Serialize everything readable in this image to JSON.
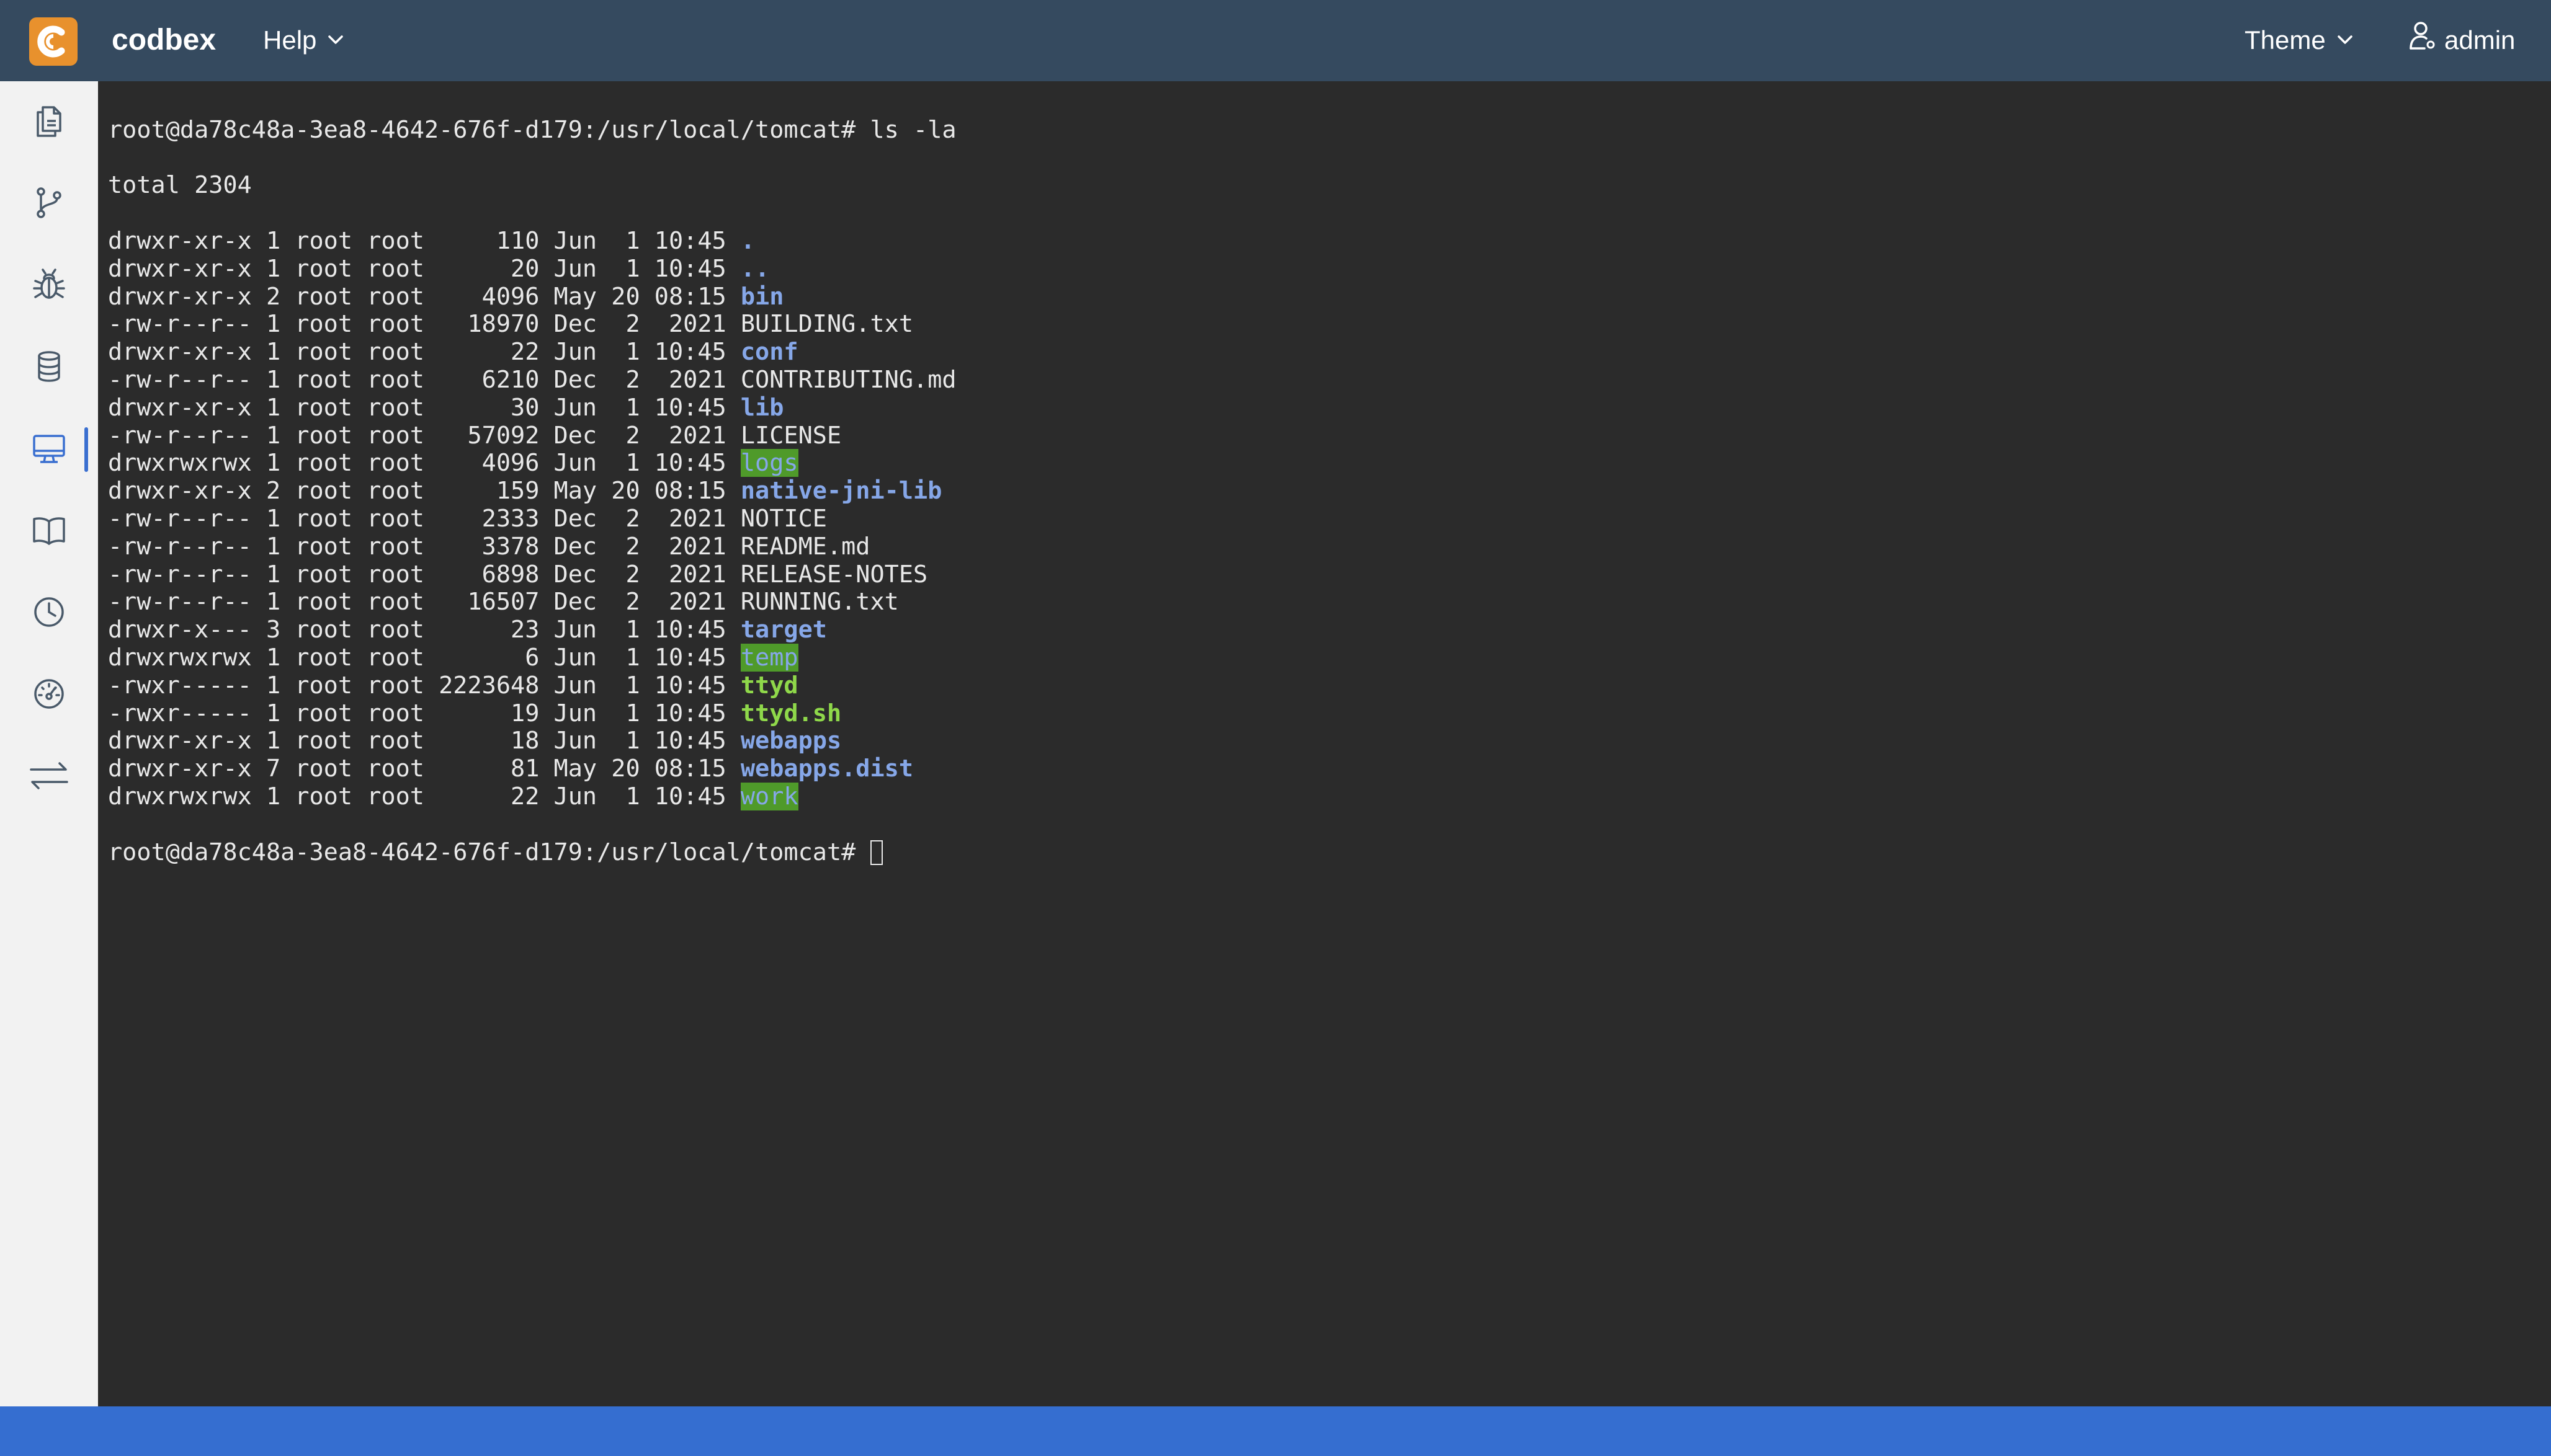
{
  "header": {
    "brand": "codbex",
    "help_label": "Help",
    "theme_label": "Theme",
    "user_label": "admin"
  },
  "colors": {
    "header_bg": "#354a5f",
    "logo_bg": "#e8912d",
    "sidebar_bg": "#f2f2f2",
    "terminal_bg": "#2b2b2b",
    "statusbar_bg": "#356ed0",
    "dir_color": "#86a7e8",
    "exec_color": "#8fd84a",
    "sticky_bg": "#4f9a2a"
  },
  "sidebar": {
    "items": [
      {
        "icon": "documents-icon",
        "name": "sidebar-item-projects"
      },
      {
        "icon": "git-branch-icon",
        "name": "sidebar-item-git"
      },
      {
        "icon": "bug-icon",
        "name": "sidebar-item-debug"
      },
      {
        "icon": "database-icon",
        "name": "sidebar-item-database"
      },
      {
        "icon": "terminal-monitor-icon",
        "name": "sidebar-item-terminal"
      },
      {
        "icon": "book-icon",
        "name": "sidebar-item-documentation"
      },
      {
        "icon": "clock-icon",
        "name": "sidebar-item-jobs"
      },
      {
        "icon": "dashboard-gauge-icon",
        "name": "sidebar-item-operations"
      },
      {
        "icon": "transfer-arrows-icon",
        "name": "sidebar-item-transport"
      }
    ],
    "active_index": 4
  },
  "terminal": {
    "prompt": "root@da78c48a-3ea8-4642-676f-d179:/usr/local/tomcat# ",
    "command": "ls -la",
    "total": "total 2304",
    "entries": [
      {
        "meta": "drwxr-xr-x 1 root root     110 Jun  1 10:45 ",
        "name": ".",
        "type": "dir"
      },
      {
        "meta": "drwxr-xr-x 1 root root      20 Jun  1 10:45 ",
        "name": "..",
        "type": "dir"
      },
      {
        "meta": "drwxr-xr-x 2 root root    4096 May 20 08:15 ",
        "name": "bin",
        "type": "dir"
      },
      {
        "meta": "-rw-r--r-- 1 root root   18970 Dec  2  2021 ",
        "name": "BUILDING.txt",
        "type": "plain"
      },
      {
        "meta": "drwxr-xr-x 1 root root      22 Jun  1 10:45 ",
        "name": "conf",
        "type": "dir"
      },
      {
        "meta": "-rw-r--r-- 1 root root    6210 Dec  2  2021 ",
        "name": "CONTRIBUTING.md",
        "type": "plain"
      },
      {
        "meta": "drwxr-xr-x 1 root root      30 Jun  1 10:45 ",
        "name": "lib",
        "type": "dir"
      },
      {
        "meta": "-rw-r--r-- 1 root root   57092 Dec  2  2021 ",
        "name": "LICENSE",
        "type": "plain"
      },
      {
        "meta": "drwxrwxrwx 1 root root    4096 Jun  1 10:45 ",
        "name": "logs",
        "type": "sticky"
      },
      {
        "meta": "drwxr-xr-x 2 root root     159 May 20 08:15 ",
        "name": "native-jni-lib",
        "type": "dir"
      },
      {
        "meta": "-rw-r--r-- 1 root root    2333 Dec  2  2021 ",
        "name": "NOTICE",
        "type": "plain"
      },
      {
        "meta": "-rw-r--r-- 1 root root    3378 Dec  2  2021 ",
        "name": "README.md",
        "type": "plain"
      },
      {
        "meta": "-rw-r--r-- 1 root root    6898 Dec  2  2021 ",
        "name": "RELEASE-NOTES",
        "type": "plain"
      },
      {
        "meta": "-rw-r--r-- 1 root root   16507 Dec  2  2021 ",
        "name": "RUNNING.txt",
        "type": "plain"
      },
      {
        "meta": "drwxr-x--- 3 root root      23 Jun  1 10:45 ",
        "name": "target",
        "type": "dir"
      },
      {
        "meta": "drwxrwxrwx 1 root root       6 Jun  1 10:45 ",
        "name": "temp",
        "type": "sticky"
      },
      {
        "meta": "-rwxr----- 1 root root 2223648 Jun  1 10:45 ",
        "name": "ttyd",
        "type": "exec"
      },
      {
        "meta": "-rwxr----- 1 root root      19 Jun  1 10:45 ",
        "name": "ttyd.sh",
        "type": "exec"
      },
      {
        "meta": "drwxr-xr-x 1 root root      18 Jun  1 10:45 ",
        "name": "webapps",
        "type": "dir"
      },
      {
        "meta": "drwxr-xr-x 7 root root      81 May 20 08:15 ",
        "name": "webapps.dist",
        "type": "dir"
      },
      {
        "meta": "drwxrwxrwx 1 root root      22 Jun  1 10:45 ",
        "name": "work",
        "type": "sticky"
      }
    ]
  }
}
